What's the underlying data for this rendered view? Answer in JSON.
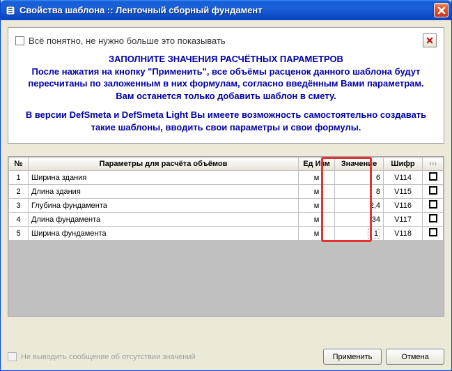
{
  "window": {
    "title": "Свойства шаблона :: Ленточный сборный фундамент"
  },
  "top_checkbox": {
    "label": "Всё понятно, не нужно больше это показывать"
  },
  "message": {
    "line1": "ЗАПОЛНИТЕ ЗНАЧЕНИЯ РАСЧЁТНЫХ ПАРАМЕТРОВ",
    "line2": "После нажатия на кнопку \"Применить\", все объёмы расценок данного шаблона будут пересчитаны по заложенным в них формулам, согласно введённым Вами параметрам.",
    "line3": "Вам останется только добавить шаблон в смету.",
    "line4": "В версии DefSmeta и DefSmeta Light Вы имеете возможность самостоятельно создавать такие шаблоны, вводить свои параметры и свои формулы."
  },
  "table": {
    "headers": {
      "num": "№",
      "name": "Параметры для расчёта объёмов",
      "unit": "Ед Изм",
      "value": "Значение",
      "code": "Шифр",
      "more": "›››"
    },
    "rows": [
      {
        "num": "1",
        "name": "Ширина здания",
        "unit": "м",
        "value": "6",
        "code": "V114"
      },
      {
        "num": "2",
        "name": "Длина здания",
        "unit": "м",
        "value": "8",
        "code": "V115"
      },
      {
        "num": "3",
        "name": "Глубина фундамента",
        "unit": "м",
        "value": "2,4",
        "code": "V116"
      },
      {
        "num": "4",
        "name": "Длина фундамента",
        "unit": "м",
        "value": "34",
        "code": "V117"
      },
      {
        "num": "5",
        "name": "Ширина фундамента",
        "unit": "м",
        "value": "1",
        "code": "V118"
      }
    ]
  },
  "bottom_checkbox": {
    "label": "Не выводить сообщение об отсутствии значений"
  },
  "buttons": {
    "apply": "Применить",
    "cancel": "Отмена"
  }
}
